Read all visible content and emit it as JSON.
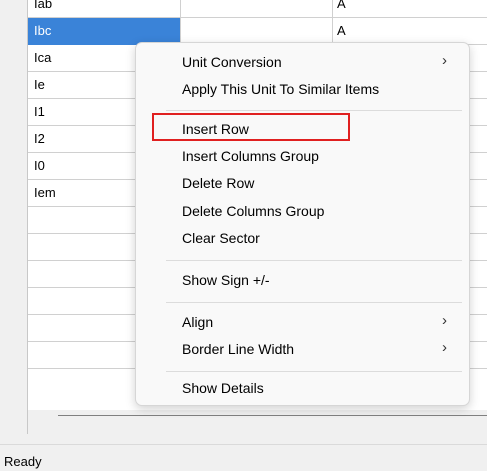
{
  "grid": {
    "rows": [
      {
        "name": "Iab",
        "value": "",
        "unit": "A"
      },
      {
        "name": "Ibc",
        "value": "",
        "unit": "A"
      },
      {
        "name": "Ica",
        "value": "",
        "unit": ""
      },
      {
        "name": "Ie",
        "value": "",
        "unit": ""
      },
      {
        "name": "I1",
        "value": "",
        "unit": ""
      },
      {
        "name": "I2",
        "value": "",
        "unit": ""
      },
      {
        "name": "I0",
        "value": "",
        "unit": ""
      },
      {
        "name": "Iem",
        "value": "",
        "unit": ""
      },
      {
        "name": "",
        "value": "",
        "unit": ""
      },
      {
        "name": "",
        "value": "",
        "unit": ""
      },
      {
        "name": "",
        "value": "",
        "unit": ""
      },
      {
        "name": "",
        "value": "",
        "unit": ""
      },
      {
        "name": "",
        "value": "",
        "unit": ""
      },
      {
        "name": "",
        "value": "",
        "unit": ""
      }
    ],
    "selected_row": 1
  },
  "context_menu": {
    "unit_conversion": "Unit Conversion",
    "apply_unit": "Apply This Unit To Similar Items",
    "insert_row": "Insert Row",
    "insert_columns_group": "Insert Columns Group",
    "delete_row": "Delete Row",
    "delete_columns_group": "Delete Columns Group",
    "clear_sector": "Clear Sector",
    "show_sign": "Show Sign +/-",
    "align": "Align",
    "border_line_width": "Border Line Width",
    "show_details": "Show Details",
    "submenu_arrow_icon": "chevron-right-icon",
    "highlighted_item": "insert_row",
    "highlight_color": "#e02020"
  },
  "status_bar": {
    "text": "Ready"
  },
  "colors": {
    "selection": "#3a83d8",
    "menu_background": "#f9f9f9"
  }
}
